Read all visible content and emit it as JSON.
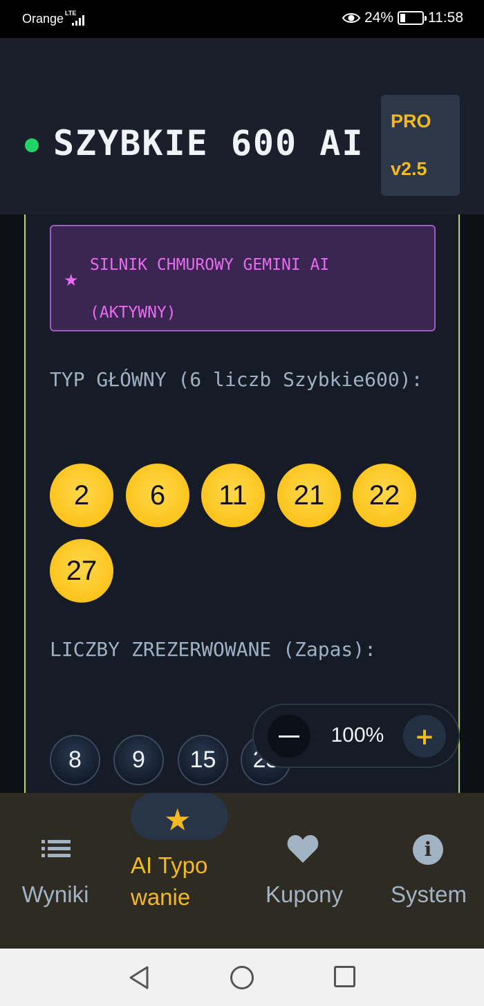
{
  "status_bar": {
    "carrier": "Orange",
    "network": "LTE",
    "battery": "24%",
    "battery_level": 0.24,
    "time": "11:58"
  },
  "header": {
    "title": "SZYBKIE 600 AI",
    "badge_line1": "PRO",
    "badge_line2": "v2.5",
    "status_color": "#22d365"
  },
  "engine": {
    "label": "SILNIK CHMUROWY GEMINI AI (AKTYWNY)",
    "icon": "star-icon"
  },
  "main_tip": {
    "title": "TYP GŁÓWNY (6 liczb Szybkie600):",
    "numbers": [
      "2",
      "6",
      "11",
      "21",
      "22",
      "27"
    ]
  },
  "reserved": {
    "title": "LICZBY ZREZERWOWANE (Zapas):",
    "numbers": [
      "8",
      "9",
      "15",
      "23"
    ]
  },
  "zoom": {
    "value": "100%",
    "minus_icon": "minus-icon",
    "plus_label": "+"
  },
  "bottom_nav": {
    "items": [
      {
        "label": "Wyniki",
        "icon": "list-icon",
        "active": false
      },
      {
        "label": "AI Typowanie",
        "icon": "star-icon",
        "active": true
      },
      {
        "label": "Kupony",
        "icon": "heart-icon",
        "active": false
      },
      {
        "label": "System",
        "icon": "info-icon",
        "active": false
      }
    ]
  },
  "colors": {
    "accent": "#f5b921",
    "ball": "#fcc41d",
    "engine": "#e86bf0",
    "border_accent": "#b9dc3a"
  }
}
